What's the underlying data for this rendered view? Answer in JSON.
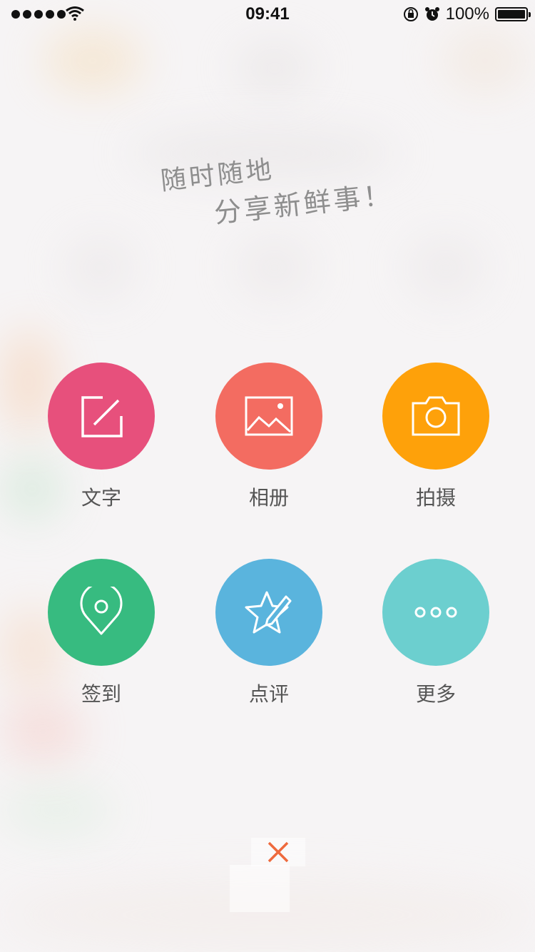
{
  "status_bar": {
    "time": "09:41",
    "battery_percent": "100%",
    "signal_bars": 5
  },
  "slogan": {
    "line1": "随时随地",
    "line2": "分享新鲜事！"
  },
  "actions": [
    {
      "label": "文字",
      "icon": "edit-icon",
      "color": "#e7507c"
    },
    {
      "label": "相册",
      "icon": "album-icon",
      "color": "#f36c61"
    },
    {
      "label": "拍摄",
      "icon": "camera-icon",
      "color": "#fea10a"
    },
    {
      "label": "签到",
      "icon": "location-pin-icon",
      "color": "#37bb80"
    },
    {
      "label": "点评",
      "icon": "star-review-icon",
      "color": "#5ab4dd"
    },
    {
      "label": "更多",
      "icon": "more-dots-icon",
      "color": "#6ccfcf"
    }
  ],
  "close": {
    "icon": "close-icon",
    "color": "#ee6a3d"
  }
}
